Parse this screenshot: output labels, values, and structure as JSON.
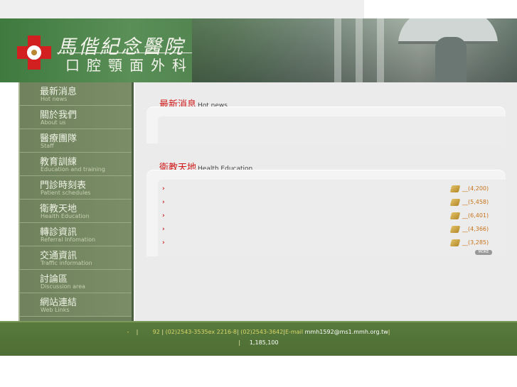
{
  "header": {
    "hospital_name": "馬偕紀念醫院",
    "department": "口腔顎面外科"
  },
  "sidebar": {
    "items": [
      {
        "zh": "最新消息",
        "en": "Hot news"
      },
      {
        "zh": "關於我們",
        "en": "About us"
      },
      {
        "zh": "醫療團隊",
        "en": "Staff"
      },
      {
        "zh": "教育訓練",
        "en": "Education and training"
      },
      {
        "zh": "門診時刻表",
        "en": "Patient schedules"
      },
      {
        "zh": "衛教天地",
        "en": "Health Education"
      },
      {
        "zh": "轉診資訊",
        "en": "Referral Infomation"
      },
      {
        "zh": "交通資訊",
        "en": "Traffic information"
      },
      {
        "zh": "討論區",
        "en": "Discussion area"
      },
      {
        "zh": "網站連結",
        "en": "Web Links"
      }
    ]
  },
  "hot_news": {
    "title_zh": "最新消息",
    "title_en": "Hot news"
  },
  "health_education": {
    "title_zh": "衛教天地",
    "title_en": "Health Education",
    "items": [
      {
        "bullet": "›",
        "count": "__(4,200)"
      },
      {
        "bullet": "›",
        "count": "__(5,458)"
      },
      {
        "bullet": "›",
        "count": "__(6,401)"
      },
      {
        "bullet": "›",
        "count": "__(4,366)"
      },
      {
        "bullet": "›",
        "count": "__(3,285)"
      }
    ],
    "more_label": "MORE"
  },
  "footer": {
    "line1_a": "-",
    "line1_b": "|",
    "line1_c": "92",
    "line1_d": "|",
    "phone": "(02)2543-3535ex 2216-8",
    "fax": "(02)2543-3642",
    "email_label": "E-mail",
    "email": "mmh1592@ms1.mmh.org.tw",
    "line2_sep": "|",
    "visit_count": "1,185,100"
  },
  "colors": {
    "banner_green": "#4f7f4d",
    "sidebar_green": "#6c7f5a",
    "footer_green": "#587a3c",
    "accent_red": "#d11a1a",
    "count_orange": "#c8731a"
  }
}
